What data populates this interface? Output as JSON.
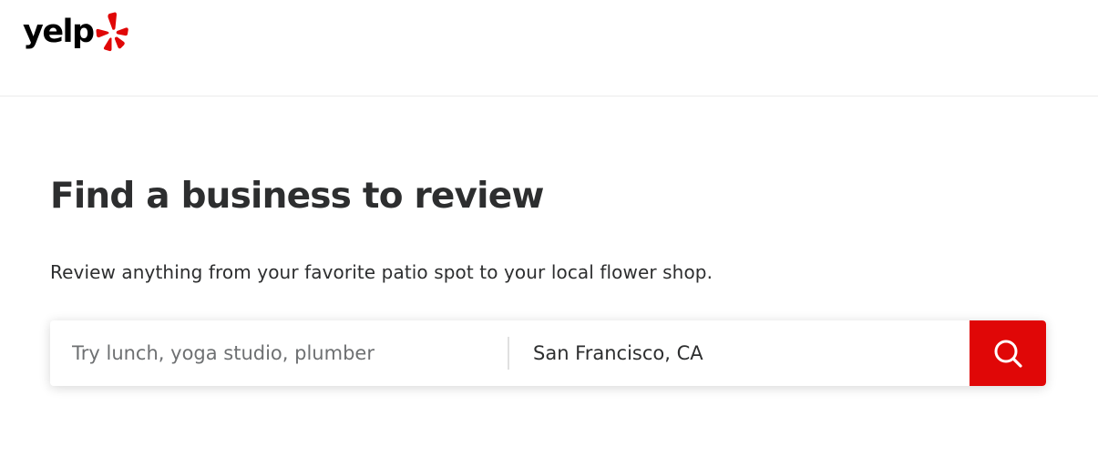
{
  "header": {
    "logo_text": "yelp"
  },
  "main": {
    "title": "Find a business to review",
    "subtitle": "Review anything from your favorite patio spot to your local flower shop."
  },
  "search": {
    "find_placeholder": "Try lunch, yoga studio, plumber",
    "find_value": "",
    "near_value": "San Francisco, CA",
    "button_icon": "search-icon"
  },
  "colors": {
    "brand_red": "#e00707",
    "text_dark": "#2d2e2f",
    "placeholder_gray": "#6e7072"
  }
}
